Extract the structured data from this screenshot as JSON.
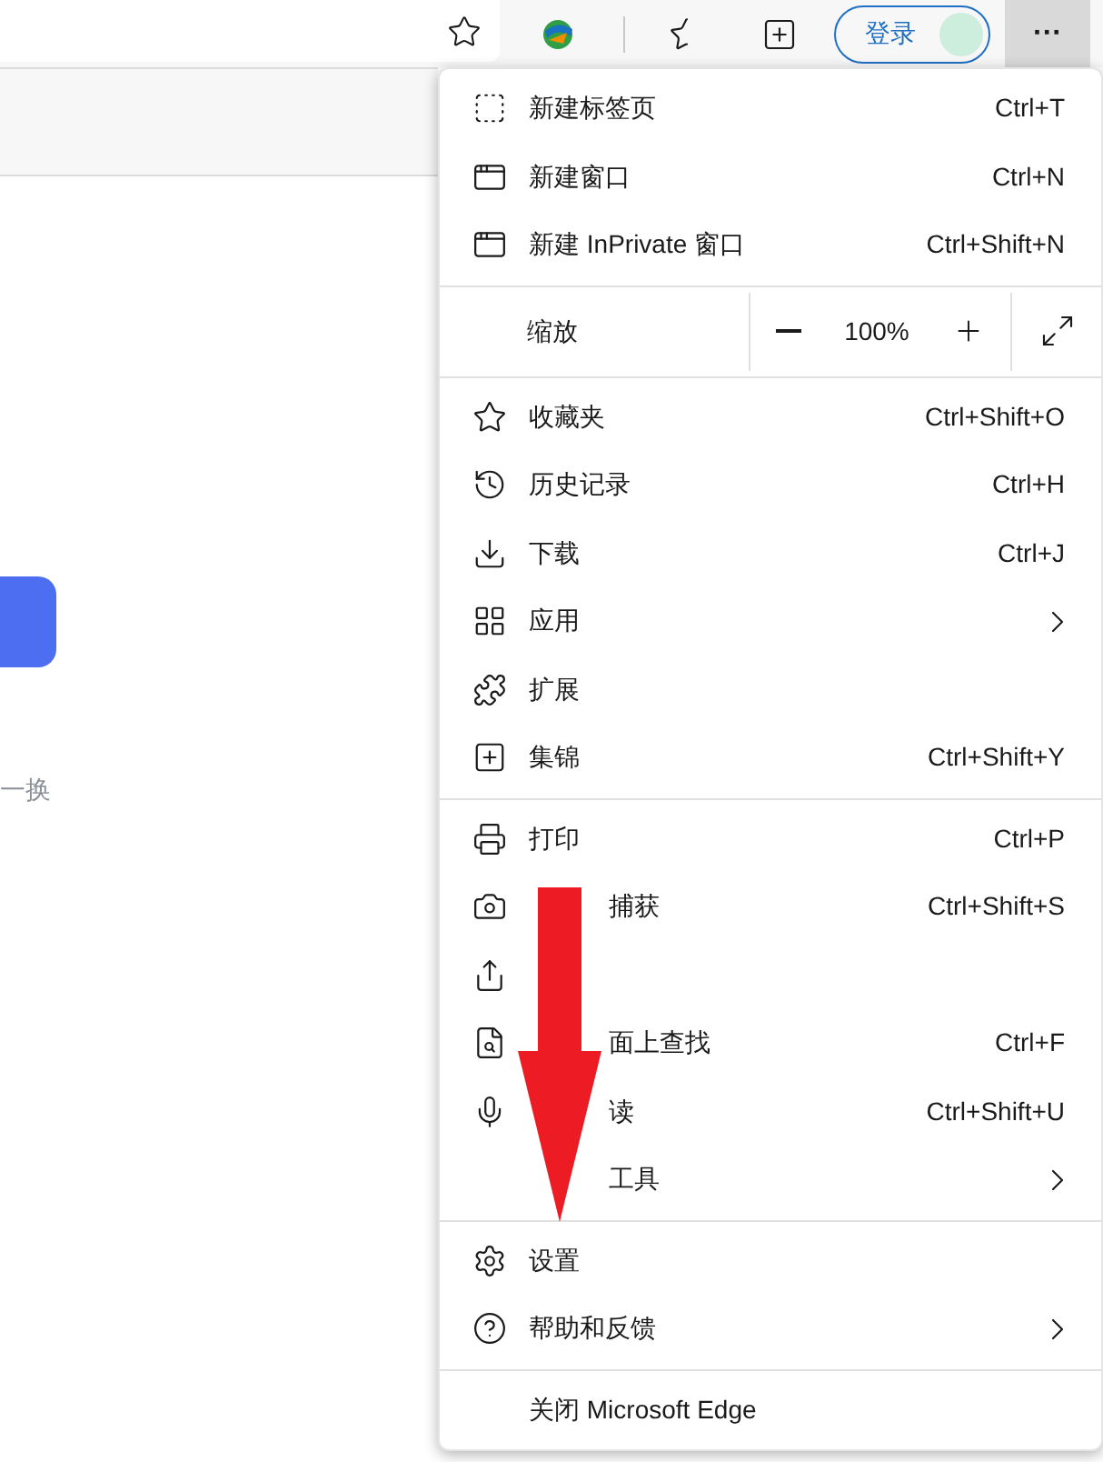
{
  "toolbar": {
    "login": "登录",
    "more": "···"
  },
  "page": {
    "link": "一换"
  },
  "menu": {
    "sections": [
      {
        "items": [
          {
            "kind": "item",
            "label": "新建标签页",
            "shortcut": "Ctrl+T"
          },
          {
            "kind": "item",
            "label": "新建窗口",
            "shortcut": "Ctrl+N"
          },
          {
            "kind": "item",
            "label": "新建 InPrivate 窗口",
            "shortcut": "Ctrl+Shift+N"
          }
        ]
      },
      {
        "items": [
          {
            "kind": "zoom",
            "label": "缩放",
            "value": "100%"
          }
        ]
      },
      {
        "items": [
          {
            "kind": "item",
            "label": "收藏夹",
            "shortcut": "Ctrl+Shift+O"
          },
          {
            "kind": "item",
            "label": "历史记录",
            "shortcut": "Ctrl+H"
          },
          {
            "kind": "item",
            "label": "下载",
            "shortcut": "Ctrl+J"
          },
          {
            "kind": "submenu",
            "label": "应用"
          },
          {
            "kind": "item",
            "label": "扩展"
          },
          {
            "kind": "item",
            "label": "集锦",
            "shortcut": "Ctrl+Shift+Y"
          }
        ]
      },
      {
        "items": [
          {
            "kind": "item",
            "label": "打印",
            "shortcut": "Ctrl+P"
          },
          {
            "kind": "item",
            "covered": true,
            "label": "捕获",
            "shortcut": "Ctrl+Shift+S"
          },
          {
            "kind": "item"
          },
          {
            "kind": "item",
            "covered": true,
            "label": "面上查找",
            "shortcut": "Ctrl+F"
          },
          {
            "kind": "item",
            "covered": true,
            "label": "读",
            "shortcut": "Ctrl+Shift+U"
          },
          {
            "kind": "submenu",
            "covered": true,
            "label": "工具"
          }
        ]
      },
      {
        "items": [
          {
            "kind": "item",
            "label": "设置"
          },
          {
            "kind": "submenu",
            "label": "帮助和反馈"
          }
        ]
      },
      {
        "items": [
          {
            "kind": "item",
            "label": "关闭 Microsoft Edge"
          }
        ]
      }
    ]
  }
}
